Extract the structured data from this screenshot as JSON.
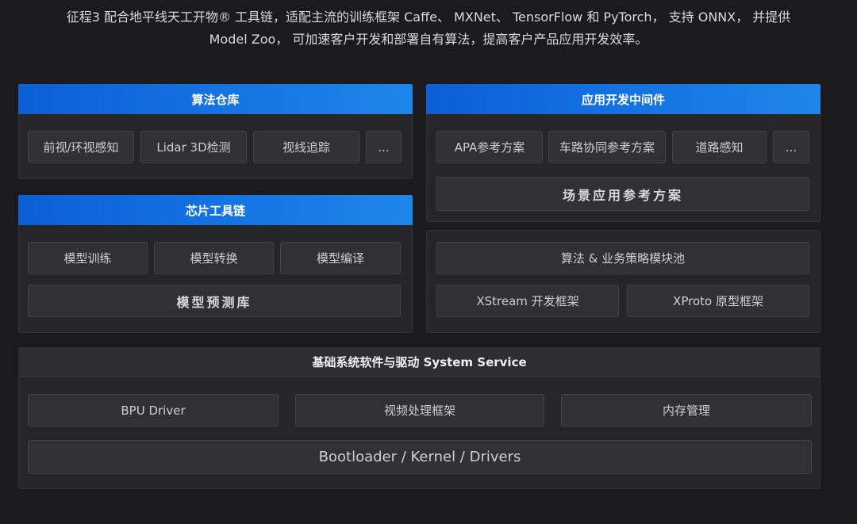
{
  "intro": {
    "line1": "征程3 配合地平线天工开物® 工具链，适配主流的训练框架 Caffe、 MXNet、 TensorFlow 和 PyTorch， 支持 ONNX， 并提供",
    "line2": "Model Zoo， 可加速客户开发和部署自有算法，提高客户产品应用开发效率。"
  },
  "algo_repo": {
    "title": "算法仓库",
    "items": [
      "前视/环视感知",
      "Lidar 3D检测",
      "视线追踪",
      "..."
    ]
  },
  "chip_toolchain": {
    "title": "芯片工具链",
    "items": [
      "模型训练",
      "模型转换",
      "模型编译"
    ],
    "bottom": "模型预测库"
  },
  "middleware": {
    "title": "应用开发中间件",
    "items": [
      "APA参考方案",
      "车路协同参考方案",
      "道路感知",
      "..."
    ],
    "bottom": "场景应用参考方案"
  },
  "strategy": {
    "top": "算法 & 业务策略模块池",
    "items": [
      "XStream 开发框架",
      "XProto 原型框架"
    ]
  },
  "system": {
    "title": "基础系统软件与驱动 System Service",
    "items": [
      "BPU Driver",
      "视频处理框架",
      "内存管理"
    ],
    "bottom": "Bootloader / Kernel / Drivers"
  }
}
